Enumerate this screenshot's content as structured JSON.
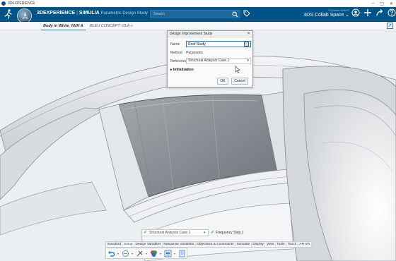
{
  "os": {
    "title": "3DEXPERIENCE",
    "minimize": "–",
    "maximize": "▢",
    "close": "✕"
  },
  "topbar": {
    "brand_bold": "3DEXPERIENCE",
    "brand_sep": "|",
    "brand_name": "SIMULIA",
    "app_name": "Parametric Design Study",
    "compass_version": "V.R",
    "search_placeholder": "Search",
    "user_name": "Christine PHILIP",
    "collab_space": "3DS Collab Space",
    "colors": {
      "bar": "#005386",
      "accent": "#1a7bd0"
    }
  },
  "tabs": [
    {
      "label": "Body in White_NVH A",
      "active": true
    },
    {
      "label": "BLEU CONCEPT V3.A",
      "active": false
    }
  ],
  "tab_add": "+",
  "dialog": {
    "title": "Design Improvement Study",
    "close": "✕",
    "name_label": "Name",
    "name_value": "Roof Study",
    "method_label": "Method",
    "method_value": "Parametric",
    "reference_label": "Reference",
    "reference_value": "Structural Analysis Case.1",
    "section_label": "Initialization",
    "ok_label": "OK",
    "cancel_label": "Cancel"
  },
  "action_bar": {
    "case_select": "Structural Analysis Case.1",
    "frequency": "Frequency Step.1",
    "tabs": [
      "Standard",
      "Setup",
      "Design Variables",
      "Response Variables",
      "Objectives & Constraints",
      "Simulate",
      "Display",
      "View",
      "Tools",
      "Touch",
      "AR-VR"
    ],
    "active_tab": "Setup",
    "tools": [
      "undo-icon",
      "variable-icon",
      "constraint-icon",
      "color-icon",
      "list-icon",
      "document-icon"
    ]
  }
}
